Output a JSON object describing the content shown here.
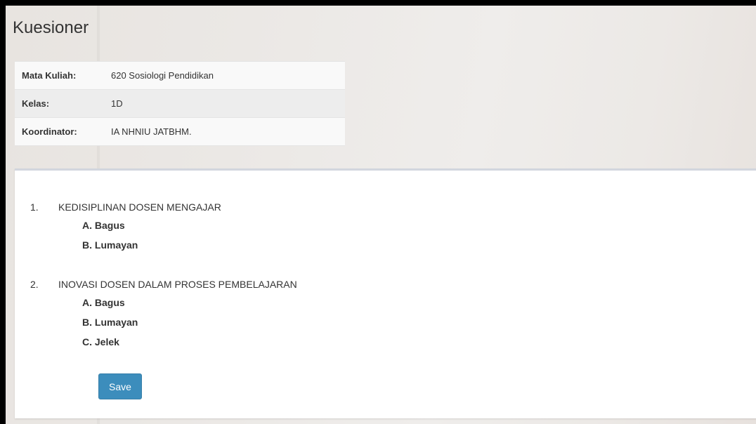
{
  "page": {
    "title": "Kuesioner"
  },
  "info": {
    "rows": [
      {
        "label": "Mata Kuliah:",
        "value": "620 Sosiologi Pendidikan"
      },
      {
        "label": "Kelas:",
        "value": "1D"
      },
      {
        "label": "Koordinator:",
        "value": "IA NHNIU JATBHM."
      }
    ]
  },
  "questions": [
    {
      "number": "1.",
      "text": "KEDISIPLINAN DOSEN MENGAJAR",
      "options": [
        "A. Bagus",
        "B. Lumayan"
      ]
    },
    {
      "number": "2.",
      "text": "INOVASI DOSEN DALAM PROSES PEMBELAJARAN",
      "options": [
        "A. Bagus",
        "B. Lumayan",
        "C. Jelek"
      ]
    }
  ],
  "form": {
    "save_label": "Save"
  },
  "colors": {
    "primary": "#3c8dbc",
    "panel_border": "#d2d6de"
  }
}
